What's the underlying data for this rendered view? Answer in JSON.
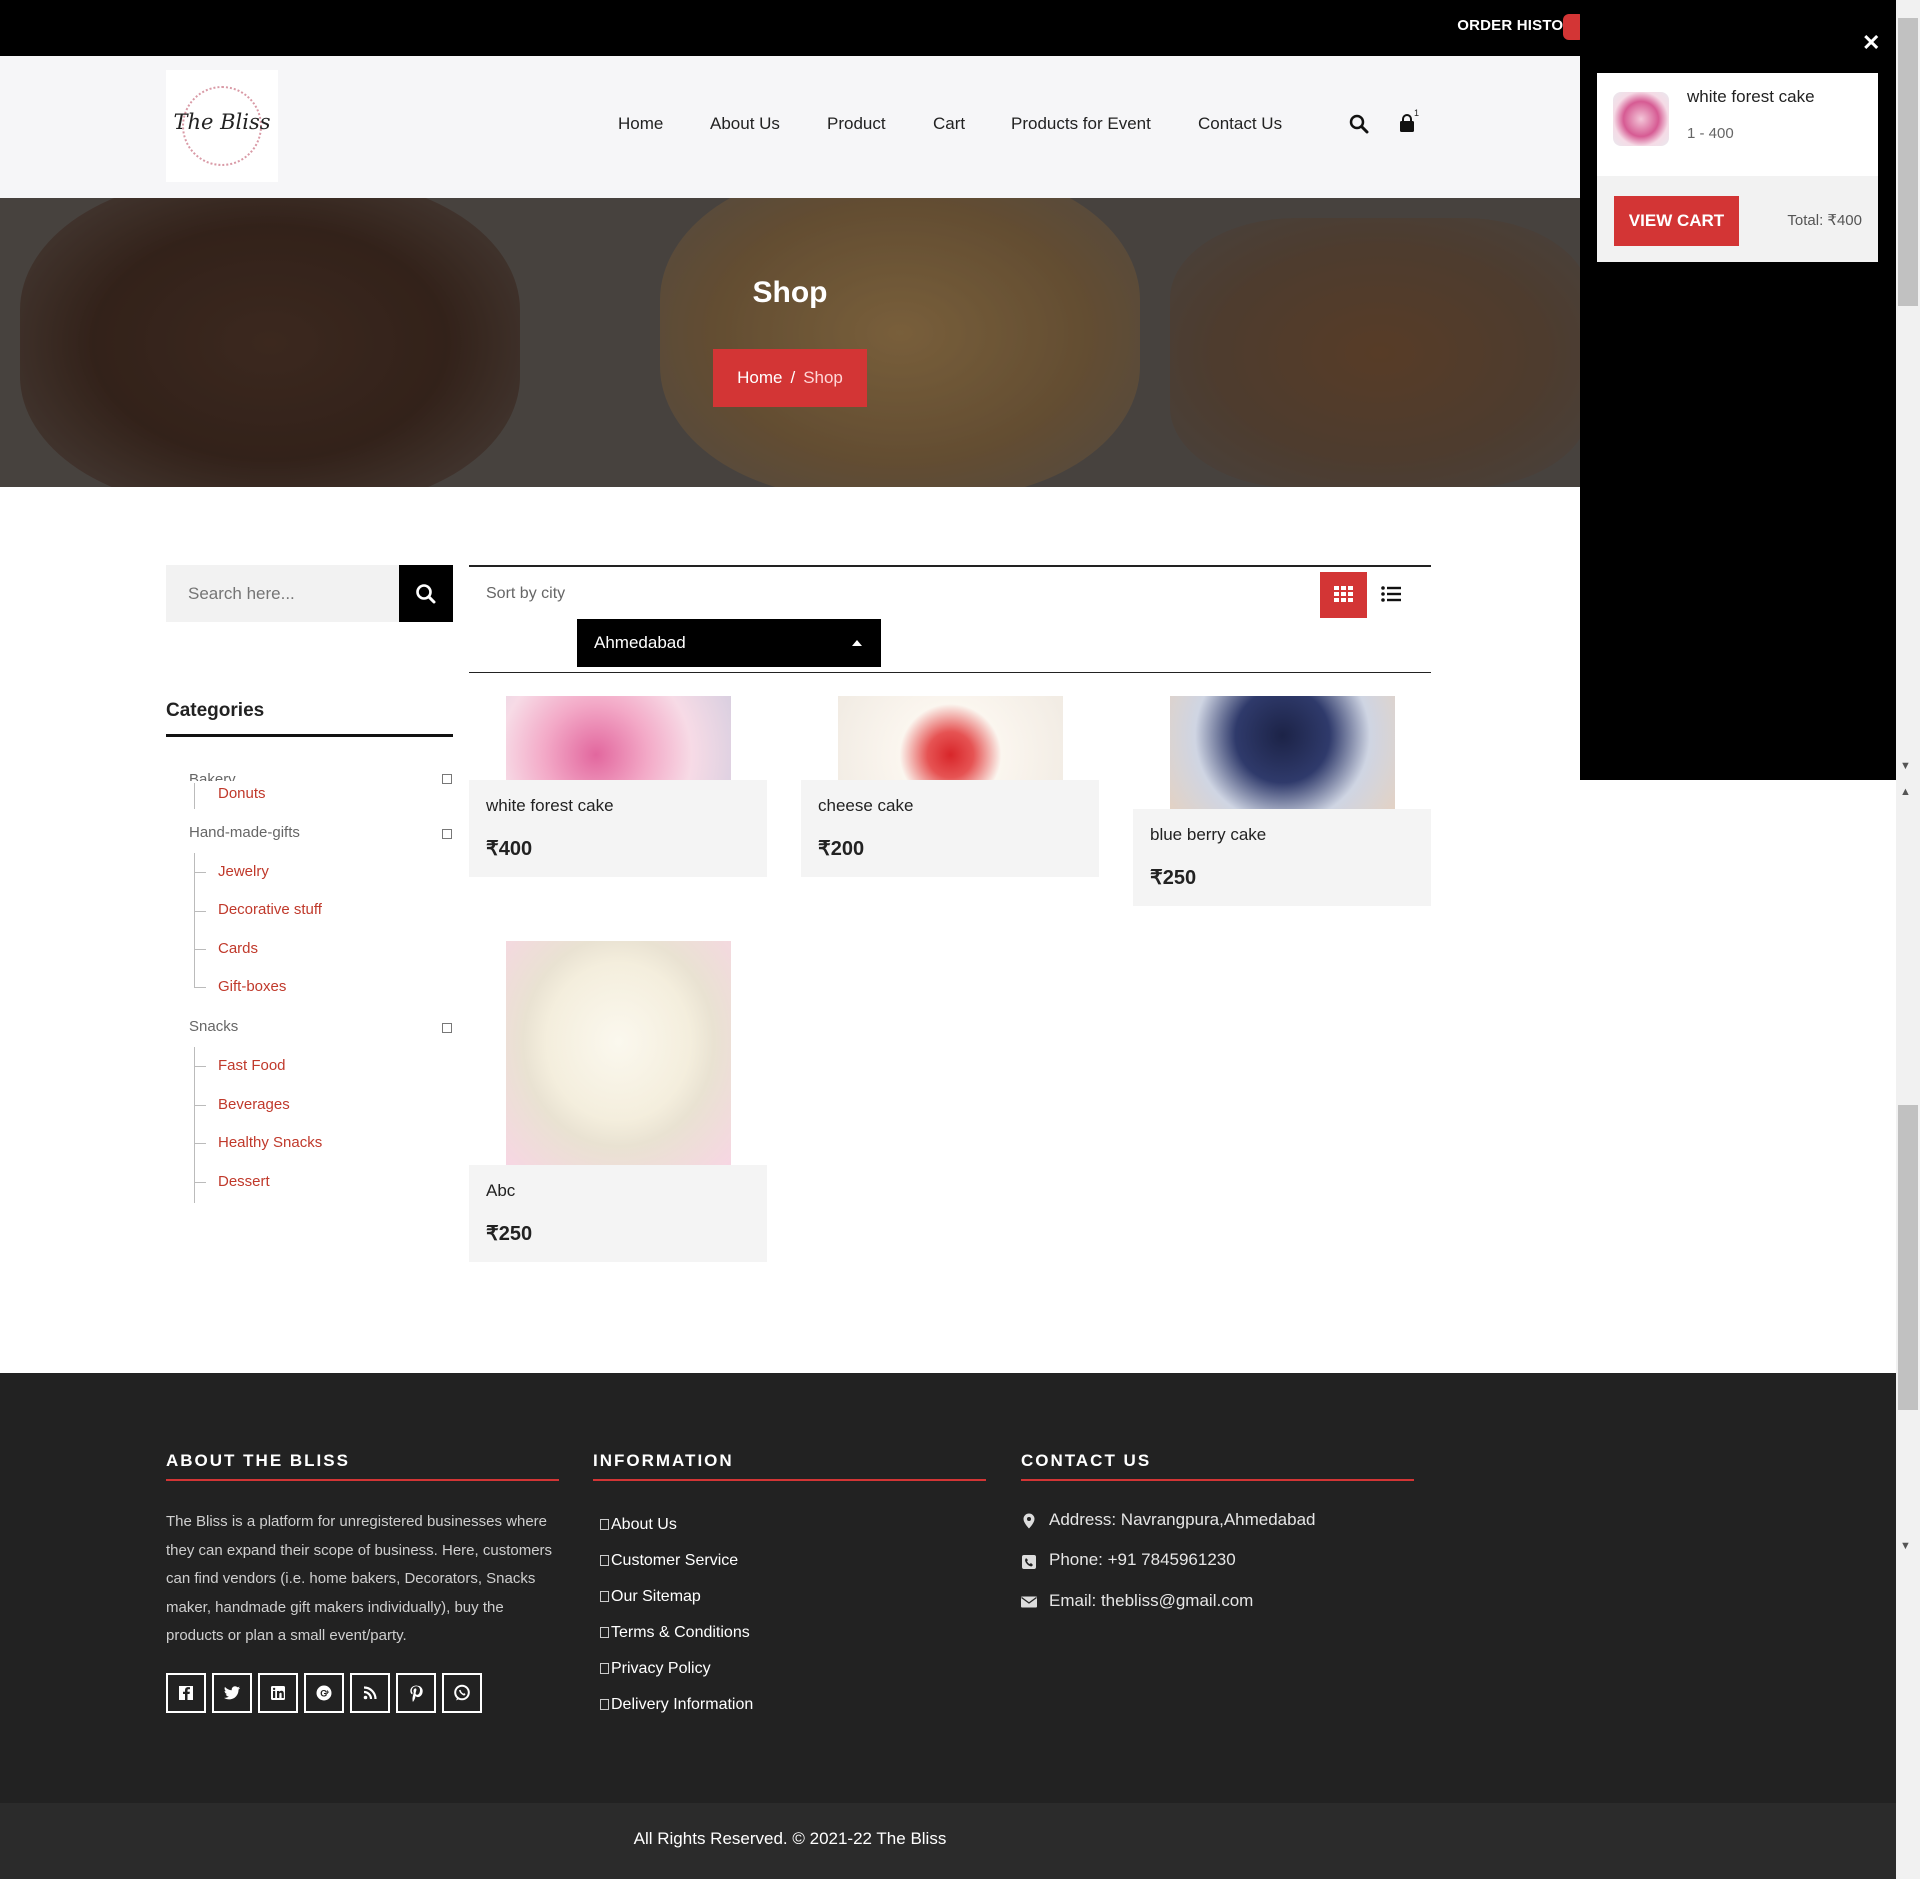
{
  "topbar": {
    "order_history": "ORDER HISTORY"
  },
  "brand": {
    "logo_text": "The Bliss"
  },
  "nav": {
    "items": [
      "Home",
      "About Us",
      "Product",
      "Cart",
      "Products for Event",
      "Contact Us"
    ],
    "cart_count": "1"
  },
  "hero": {
    "title": "Shop",
    "breadcrumb_home": "Home",
    "breadcrumb_sep": "/",
    "breadcrumb_current": "Shop"
  },
  "cart_panel": {
    "item_name": "white forest cake",
    "item_qty": "1 - 400",
    "view_cart": "VIEW CART",
    "total_label": "Total:",
    "total_value": "₹400"
  },
  "sidebar": {
    "search_placeholder": "Search here...",
    "categories_title": "Categories",
    "groups": [
      {
        "name": "Bakery",
        "items": [
          "Donuts"
        ]
      },
      {
        "name": "Hand-made-gifts",
        "items": [
          "Jewelry",
          "Decorative stuff",
          "Cards",
          "Gift-boxes"
        ]
      },
      {
        "name": "Snacks",
        "items": [
          "Fast Food",
          "Beverages",
          "Healthy Snacks",
          "Dessert"
        ]
      }
    ]
  },
  "toolbar": {
    "sort_label": "Sort by city",
    "city": "Ahmedabad"
  },
  "products": [
    {
      "name": "white forest cake",
      "price": "₹400"
    },
    {
      "name": "cheese cake",
      "price": "₹200"
    },
    {
      "name": "blue berry cake",
      "price": "₹250"
    },
    {
      "name": "Abc",
      "price": "₹250"
    }
  ],
  "footer": {
    "about_title": "ABOUT THE BLISS",
    "about_text": "The Bliss is a platform for unregistered businesses where they can expand their scope of business. Here, customers can find vendors (i.e. home bakers, Decorators, Snacks maker, handmade gift makers individually), buy the products or plan a small event/party.",
    "info_title": "INFORMATION",
    "info_links": [
      "About Us",
      "Customer Service",
      "Our Sitemap",
      "Terms & Conditions",
      "Privacy Policy",
      "Delivery Information"
    ],
    "contact_title": "CONTACT US",
    "address": "Address: Navrangpura,Ahmedabad",
    "phone": "Phone: +91 7845961230",
    "email": "Email: thebliss@gmail.com",
    "social_icons": [
      "facebook-icon",
      "twitter-icon",
      "linkedin-icon",
      "google-plus-icon",
      "rss-icon",
      "pinterest-icon",
      "whatsapp-icon"
    ],
    "copyright": "All Rights Reserved. © 2021-22 The Bliss"
  },
  "colors": {
    "accent": "#d33535",
    "dark": "#222222",
    "black": "#000000"
  }
}
